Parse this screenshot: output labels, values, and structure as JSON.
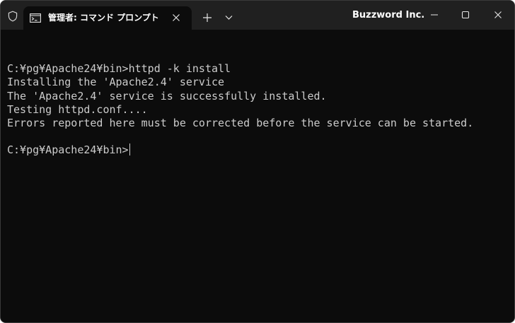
{
  "window": {
    "brand": "Buzzword Inc."
  },
  "tab": {
    "title": "管理者: コマンド プロンプト"
  },
  "icons": {
    "shield": "shield-icon",
    "tab": "command-prompt-icon",
    "tab_close": "close-icon",
    "new_tab": "plus-icon",
    "dropdown": "chevron-down-icon",
    "minimize": "minimize-icon",
    "maximize": "maximize-icon",
    "close": "close-icon"
  },
  "terminal": {
    "lines": [
      "",
      "C:¥pg¥Apache24¥bin>httpd -k install",
      "Installing the 'Apache2.4' service",
      "The 'Apache2.4' service is successfully installed.",
      "Testing httpd.conf....",
      "Errors reported here must be corrected before the service can be started.",
      ""
    ],
    "prompt": "C:¥pg¥Apache24¥bin>"
  },
  "colors": {
    "titlebar": "#202020",
    "background": "#0c0c0c",
    "text": "#cccccc"
  }
}
